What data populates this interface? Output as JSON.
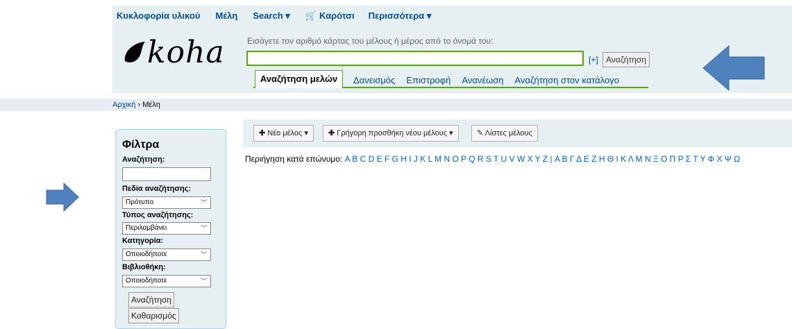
{
  "nav": {
    "items": [
      "Κυκλοφορία υλικού",
      "Μέλη",
      "Search ▾",
      "Καρότσι",
      "Περισσότερα ▾"
    ],
    "cart_icon": "cart-icon"
  },
  "logo": {
    "text": "koha"
  },
  "search": {
    "hint": "Εισάγετε τον αριθμό κάρτας του μέλους ή μέρος από το όνομά του:",
    "value": "",
    "plus": "[+]",
    "button": "Αναζήτηση"
  },
  "tabs": {
    "active": "Αναζήτηση μελών",
    "items": [
      "Δανεισμός",
      "Επιστροφή",
      "Ανανέωση",
      "Αναζήτηση στον κατάλογο"
    ]
  },
  "breadcrumb": {
    "home": "Αρχική",
    "sep": "›",
    "current": "Μέλη"
  },
  "toolbar": {
    "new_member": "Νέο μέλος",
    "quick_add": "Γρήγορη προσθήκη νέου μέλους",
    "lists": "Λίστες μέλους"
  },
  "browse": {
    "label": "Περιήγηση κατά επώνυμο:",
    "letters": "A B C D E F G H I J K L M N O P Q R S T U V W X Y Z | Α Β Γ Δ Ε Ζ Η Θ Ι Κ Λ Μ Ν Ξ Ο Π Ρ Σ Τ Υ Φ Χ Ψ Ω"
  },
  "filters": {
    "title": "Φίλτρα",
    "search_label": "Αναζήτηση:",
    "search_value": "",
    "fields_label": "Πεδία αναζήτησης:",
    "fields_value": "Πρότυπο",
    "type_label": "Τύπος αναζήτησης:",
    "type_value": "Περιλαμβάνει",
    "category_label": "Κατηγορία:",
    "category_value": "Οποιοδήποτε",
    "library_label": "Βιβλιοθήκη:",
    "library_value": "Οποιοδήποτε",
    "search_button": "Αναζήτηση",
    "clear_button": "Καθαρισμός"
  },
  "colors": {
    "accent_green": "#5aa800",
    "header_bg": "#e6f0f2",
    "link": "#004d99",
    "arrow": "#4f81bd"
  }
}
